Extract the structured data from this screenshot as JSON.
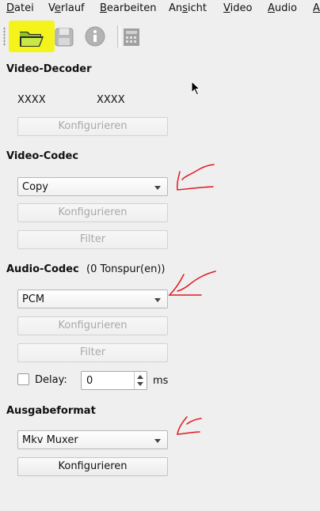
{
  "menubar": {
    "items": [
      "Datei",
      "Verlauf",
      "Bearbeiten",
      "Ansicht",
      "Video",
      "Audio",
      "A"
    ],
    "mnemonics": [
      "D",
      "e",
      "B",
      "s",
      "V",
      "A",
      "A"
    ]
  },
  "toolbar": {
    "open_icon": "folder-open-icon",
    "save_icon": "save-icon",
    "info_icon": "info-icon",
    "calc_icon": "film-calculator-icon",
    "highlight_color": "#f4f41c"
  },
  "video_decoder": {
    "title": "Video-Decoder",
    "value1": "XXXX",
    "value2": "XXXX",
    "configure": "Konfigurieren"
  },
  "video_codec": {
    "title": "Video-Codec",
    "selected": "Copy",
    "configure": "Konfigurieren",
    "filter": "Filter"
  },
  "audio_codec": {
    "title": "Audio-Codec",
    "tracks": "(0 Tonspur(en))",
    "selected": "PCM",
    "configure": "Konfigurieren",
    "filter": "Filter",
    "delay_label": "Delay:",
    "delay_value": "0",
    "delay_unit": "ms"
  },
  "output_format": {
    "title": "Ausgabeformat",
    "selected": "Mkv Muxer",
    "configure": "Konfigurieren"
  },
  "annotation_color": "#e0191f"
}
